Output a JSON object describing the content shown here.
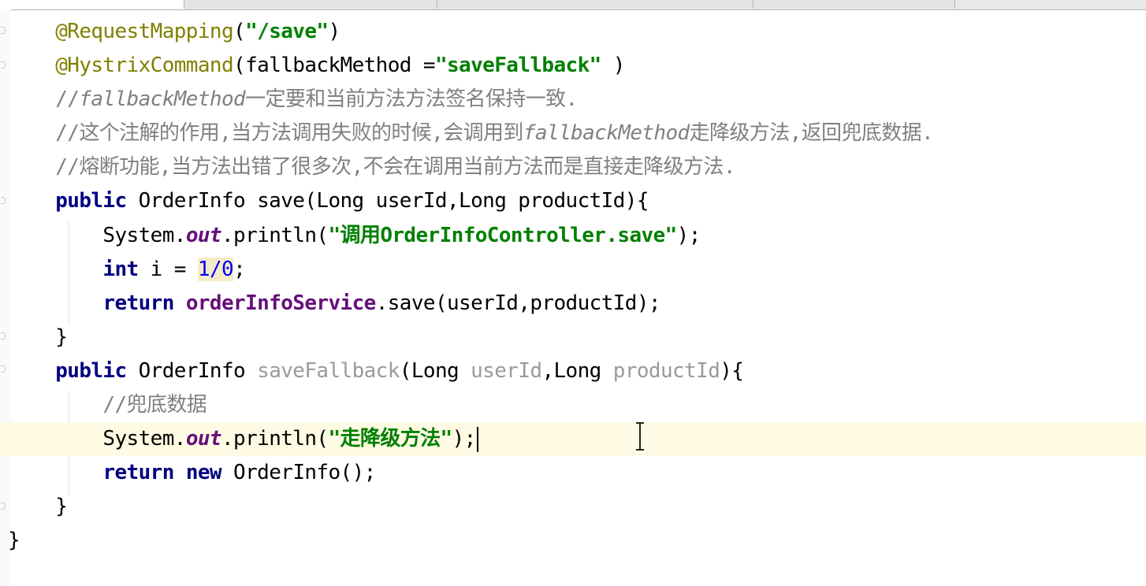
{
  "editor": {
    "lines": [
      {
        "id": "l1",
        "segments": [
          {
            "t": "    "
          },
          {
            "c": "annotation",
            "t": "@RequestMapping"
          },
          {
            "t": "("
          },
          {
            "c": "str",
            "t": "\"/save\""
          },
          {
            "t": ")"
          }
        ]
      },
      {
        "id": "l2",
        "segments": [
          {
            "t": "    "
          },
          {
            "c": "annotation",
            "t": "@HystrixCommand"
          },
          {
            "t": "(fallbackMethod ="
          },
          {
            "c": "str",
            "t": "\"saveFallback\""
          },
          {
            "t": " )"
          }
        ]
      },
      {
        "id": "l3",
        "segments": [
          {
            "t": "    "
          },
          {
            "c": "cmt",
            "t": "//"
          },
          {
            "c": "cmt-it",
            "t": "fallbackMethod"
          },
          {
            "c": "cmt",
            "t": "一定要和当前方法方法签名保持一致."
          }
        ]
      },
      {
        "id": "l4",
        "segments": [
          {
            "t": "    "
          },
          {
            "c": "cmt",
            "t": "//这个注解的作用,当方法调用失败的时候,会调用到"
          },
          {
            "c": "cmt-it",
            "t": "fallbackMethod"
          },
          {
            "c": "cmt",
            "t": "走降级方法,返回兜底数据."
          }
        ]
      },
      {
        "id": "l5",
        "segments": [
          {
            "t": "    "
          },
          {
            "c": "cmt",
            "t": "//熔断功能,当方法出错了很多次,不会在调用当前方法而是直接走降级方法."
          }
        ]
      },
      {
        "id": "l6",
        "segments": [
          {
            "t": "    "
          },
          {
            "c": "kw",
            "t": "public"
          },
          {
            "t": " OrderInfo save(Long userId,Long productId){"
          }
        ]
      },
      {
        "id": "l7",
        "segments": [
          {
            "t": "        System."
          },
          {
            "c": "field-it",
            "t": "out"
          },
          {
            "t": ".println("
          },
          {
            "c": "str",
            "t": "\"调用OrderInfoController.save\""
          },
          {
            "t": ");"
          }
        ]
      },
      {
        "id": "l8",
        "segments": [
          {
            "t": "        "
          },
          {
            "c": "kw",
            "t": "int"
          },
          {
            "t": " i = "
          },
          {
            "c": "num hl",
            "t": "1/0"
          },
          {
            "t": ";"
          }
        ]
      },
      {
        "id": "l9",
        "segments": [
          {
            "t": "        "
          },
          {
            "c": "kw",
            "t": "return"
          },
          {
            "t": " "
          },
          {
            "c": "field",
            "t": "orderInfoService"
          },
          {
            "t": ".save(userId,productId);"
          }
        ]
      },
      {
        "id": "l10",
        "segments": [
          {
            "t": "    }"
          }
        ]
      },
      {
        "id": "l11",
        "segments": [
          {
            "t": "    "
          },
          {
            "c": "kw",
            "t": "public"
          },
          {
            "t": " OrderInfo "
          },
          {
            "c": "unused",
            "t": "saveFallback"
          },
          {
            "t": "(Long "
          },
          {
            "c": "unused",
            "t": "userId"
          },
          {
            "t": ",Long "
          },
          {
            "c": "unused",
            "t": "productId"
          },
          {
            "t": "){"
          }
        ]
      },
      {
        "id": "l12",
        "segments": [
          {
            "t": "        "
          },
          {
            "c": "cmt",
            "t": "//兜底数据"
          }
        ]
      },
      {
        "id": "l13",
        "current": true,
        "caret": true,
        "segments": [
          {
            "t": "        System."
          },
          {
            "c": "field-it",
            "t": "out"
          },
          {
            "t": ".println("
          },
          {
            "c": "str",
            "t": "\"走降级方法\""
          },
          {
            "t": ");"
          }
        ]
      },
      {
        "id": "l14",
        "segments": [
          {
            "t": "        "
          },
          {
            "c": "kw",
            "t": "return"
          },
          {
            "t": " "
          },
          {
            "c": "kw",
            "t": "new"
          },
          {
            "t": " OrderInfo();"
          }
        ]
      },
      {
        "id": "l15",
        "segments": [
          {
            "t": "    }"
          }
        ]
      },
      {
        "id": "l16",
        "segments": [
          {
            "t": "}"
          }
        ]
      }
    ]
  }
}
